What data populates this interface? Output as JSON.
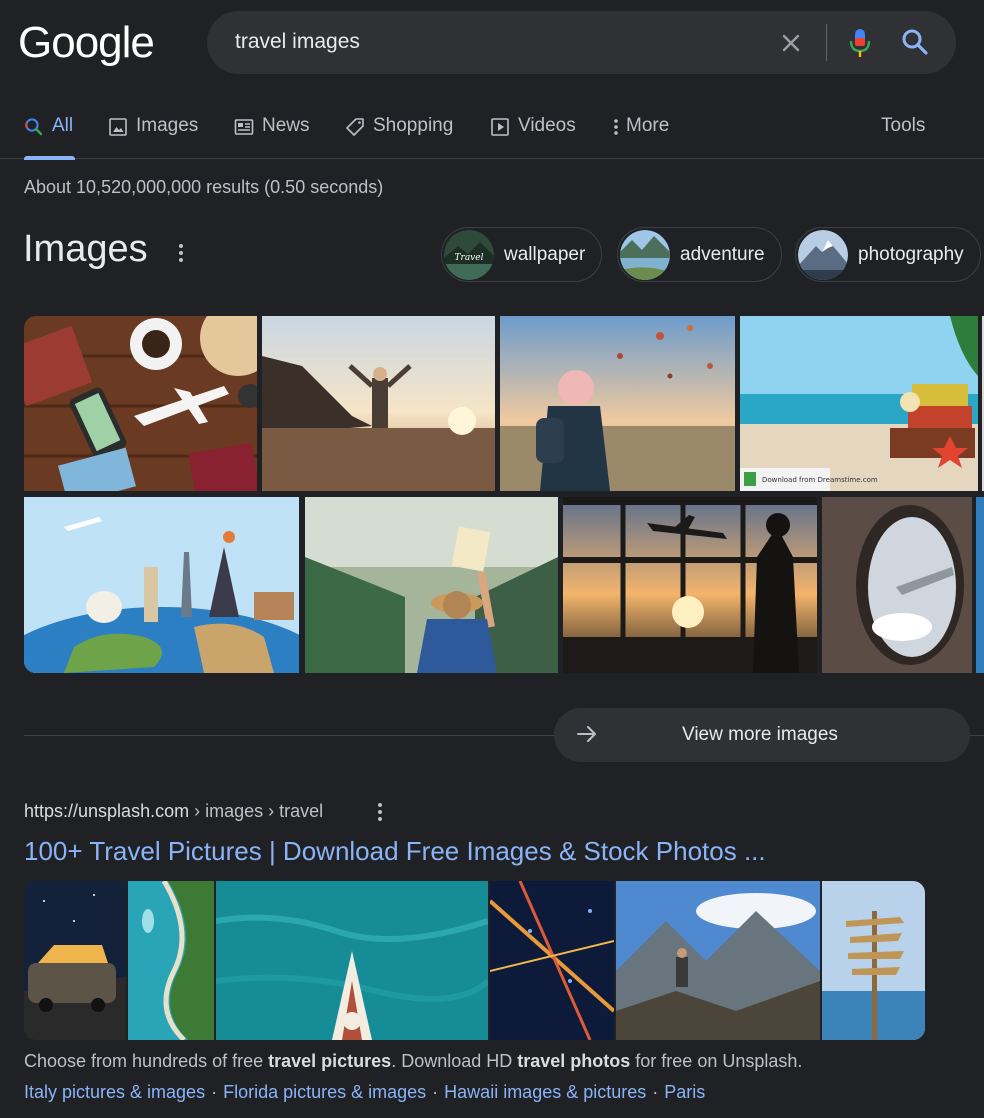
{
  "header": {
    "logo_text": "Google",
    "search_value": "travel images",
    "icons": [
      "close-icon",
      "microphone-icon",
      "search-icon"
    ]
  },
  "tabs": [
    {
      "label": "All",
      "icon": "search-icon",
      "active": true
    },
    {
      "label": "Images",
      "icon": "image-icon"
    },
    {
      "label": "News",
      "icon": "newspaper-icon"
    },
    {
      "label": "Shopping",
      "icon": "tag-icon"
    },
    {
      "label": "Videos",
      "icon": "play-icon"
    },
    {
      "label": "More",
      "icon": "kebab-icon"
    }
  ],
  "tools_label": "Tools",
  "result_stats": "About 10,520,000,000 results (0.50 seconds)",
  "images_section": {
    "title": "Images",
    "chips": [
      {
        "label": "wallpaper",
        "thumb_text": "Travel"
      },
      {
        "label": "adventure"
      },
      {
        "label": "photography"
      }
    ],
    "thumbnails": [
      "travel flat-lay with passport, phone, airplane model",
      "person with raised arms on beach at sunset",
      "woman watching hot air balloons",
      "suitcases on beach",
      "world landmarks on globe",
      "woman in hat holding map",
      "silhouette watching airplane at airport",
      "airplane window view"
    ],
    "watermark_text": "Download from Dreamstime.com",
    "view_more_label": "View more images"
  },
  "result": {
    "cite_domain": "https://unsplash.com",
    "cite_path": " › images › travel",
    "title": "100+ Travel Pictures | Download Free Images & Stock Photos ...",
    "snippet_parts": [
      {
        "text": "Choose from hundreds of free ",
        "bold": false
      },
      {
        "text": "travel pictures",
        "bold": true
      },
      {
        "text": ". Download HD ",
        "bold": false
      },
      {
        "text": "travel photos",
        "bold": true
      },
      {
        "text": " for free on Unsplash.",
        "bold": false
      }
    ],
    "sitelinks": [
      "Italy pictures & images",
      "Florida pictures & images",
      "Hawaii images & pictures",
      "Paris"
    ],
    "sitelink_separator": "·"
  },
  "colors": {
    "background": "#202124",
    "link": "#8ab4f8",
    "text": "#e8eaed",
    "muted": "#bdc1c6",
    "search_box": "#303134"
  }
}
